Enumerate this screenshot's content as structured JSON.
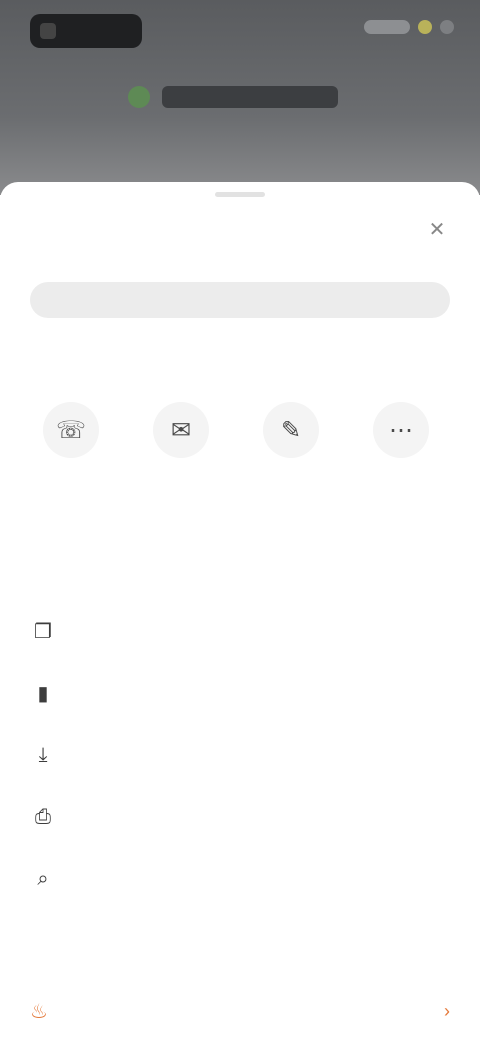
{
  "status_bar": {
    "pill_icon": "app-icon"
  },
  "background_page": {
    "title_icon": "site-icon"
  },
  "sheet": {
    "title": "",
    "close_icon": "close-icon",
    "url_value": "",
    "share_section_title": "",
    "share_targets": [
      {
        "icon": "phone-icon",
        "label": ""
      },
      {
        "icon": "message-icon",
        "label": ""
      },
      {
        "icon": "mail-icon",
        "label": ""
      },
      {
        "icon": "more-icon",
        "label": ""
      }
    ],
    "actions_section_title": "",
    "actions": [
      {
        "icon": "copy-icon",
        "label": ""
      },
      {
        "icon": "bookmark-icon",
        "label": ""
      },
      {
        "icon": "download-icon",
        "label": ""
      },
      {
        "icon": "print-icon",
        "label": ""
      },
      {
        "icon": "find-icon",
        "label": ""
      }
    ],
    "bottom_section_title": "",
    "bottom_action": {
      "icon": "flame-icon",
      "label": ""
    },
    "bottom_right_icon": "chevron-right-icon"
  },
  "colors": {
    "accent": "#e4793a",
    "backdrop": "#6b6d70",
    "sheet_background": "#ffffff"
  }
}
